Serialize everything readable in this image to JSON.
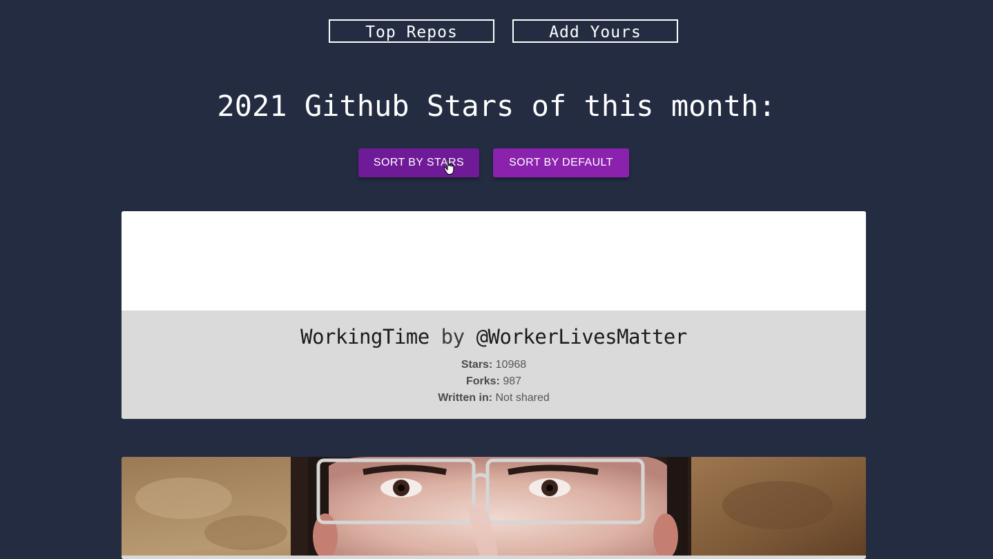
{
  "nav": {
    "top_repos_label": "Top Repos",
    "add_yours_label": "Add Yours"
  },
  "page_title": "2021 Github Stars of this month:",
  "sort": {
    "by_stars_label": "SORT BY STARS",
    "by_default_label": "SORT BY DEFAULT"
  },
  "repos": [
    {
      "name": "WorkingTime",
      "by_word": "by",
      "owner": "@WorkerLivesMatter",
      "stars_label": "Stars:",
      "stars": "10968",
      "forks_label": "Forks:",
      "forks": "987",
      "language_label": "Written in:",
      "language": "Not shared"
    }
  ],
  "colors": {
    "background": "#232c41",
    "accent": "#8a22ad",
    "card_info_bg": "#dadada"
  },
  "icons": {
    "cursor": "hand-pointer-icon"
  }
}
